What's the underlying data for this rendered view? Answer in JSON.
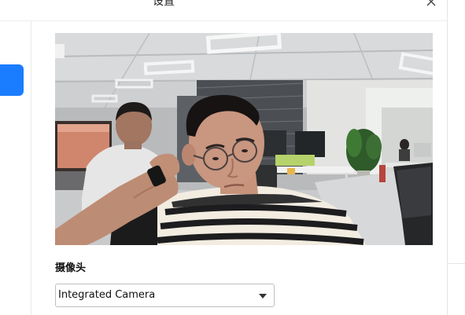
{
  "dialog": {
    "title": "设置",
    "close_icon": "close-icon"
  },
  "video": {
    "camera_label": "摄像头",
    "camera_select": {
      "value": "Integrated Camera"
    }
  },
  "colors": {
    "accent": "#1a7cff",
    "border": "#bfbfbf"
  }
}
